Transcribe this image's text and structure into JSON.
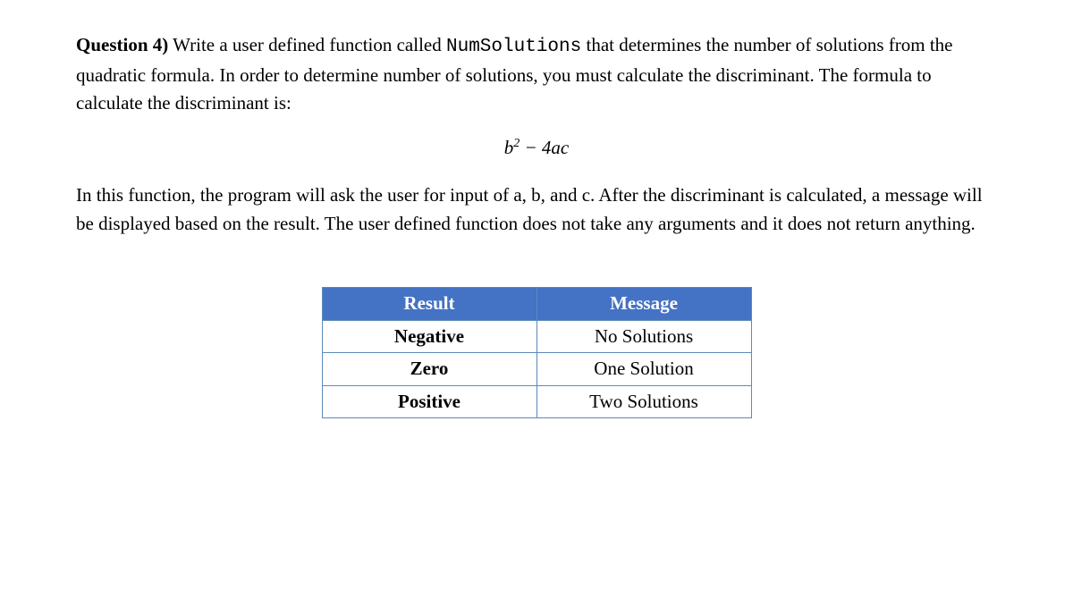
{
  "question": {
    "label": "Question 4)",
    "text_before_code": " Write a user defined function called ",
    "code_name": "NumSolutions",
    "text_after_code": " that determines the number of solutions from the quadratic formula. In order to determine number of solutions, you must calculate the discriminant. The formula to calculate the discriminant is:"
  },
  "formula": {
    "b": "b",
    "exp": "2",
    "minus": " − 4",
    "a": "a",
    "c": "c"
  },
  "paragraph2": "In this function, the program will ask the user for input of a, b, and c. After the discriminant is calculated, a message will be displayed based on the result. The user defined function does not take any arguments and it does not return anything.",
  "table": {
    "headers": {
      "result": "Result",
      "message": "Message"
    },
    "rows": [
      {
        "result": "Negative",
        "message": "No Solutions"
      },
      {
        "result": "Zero",
        "message": "One Solution"
      },
      {
        "result": "Positive",
        "message": "Two Solutions"
      }
    ]
  }
}
